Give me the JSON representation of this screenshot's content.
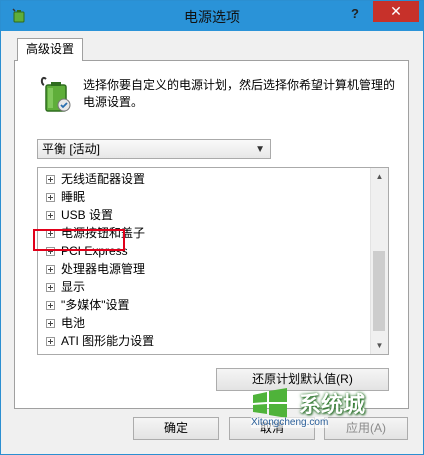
{
  "window": {
    "title": "电源选项",
    "help_label": "?",
    "close_label": "✕"
  },
  "tab": {
    "label": "高级设置"
  },
  "description": "选择你要自定义的电源计划，然后选择你希望计算机管理的电源设置。",
  "plan_select": {
    "value": "平衡 [活动]"
  },
  "tree": {
    "items": [
      {
        "label": "无线适配器设置"
      },
      {
        "label": "睡眠"
      },
      {
        "label": "USB 设置"
      },
      {
        "label": "电源按钮和盖子"
      },
      {
        "label": "PCI Express"
      },
      {
        "label": "处理器电源管理"
      },
      {
        "label": "显示"
      },
      {
        "label": "\"多媒体\"设置"
      },
      {
        "label": "电池"
      },
      {
        "label": "ATI 图形能力设置"
      }
    ],
    "highlighted_item": "显示"
  },
  "buttons": {
    "restore": "还原计划默认值(R)",
    "ok": "确定",
    "cancel": "取消",
    "apply": "应用(A)"
  },
  "watermark": {
    "text": "系统城",
    "url": "Xitongcheng.com"
  },
  "colors": {
    "titlebar": "#2a93d8",
    "close_button": "#c7312a",
    "highlight_border": "#e1001a"
  }
}
